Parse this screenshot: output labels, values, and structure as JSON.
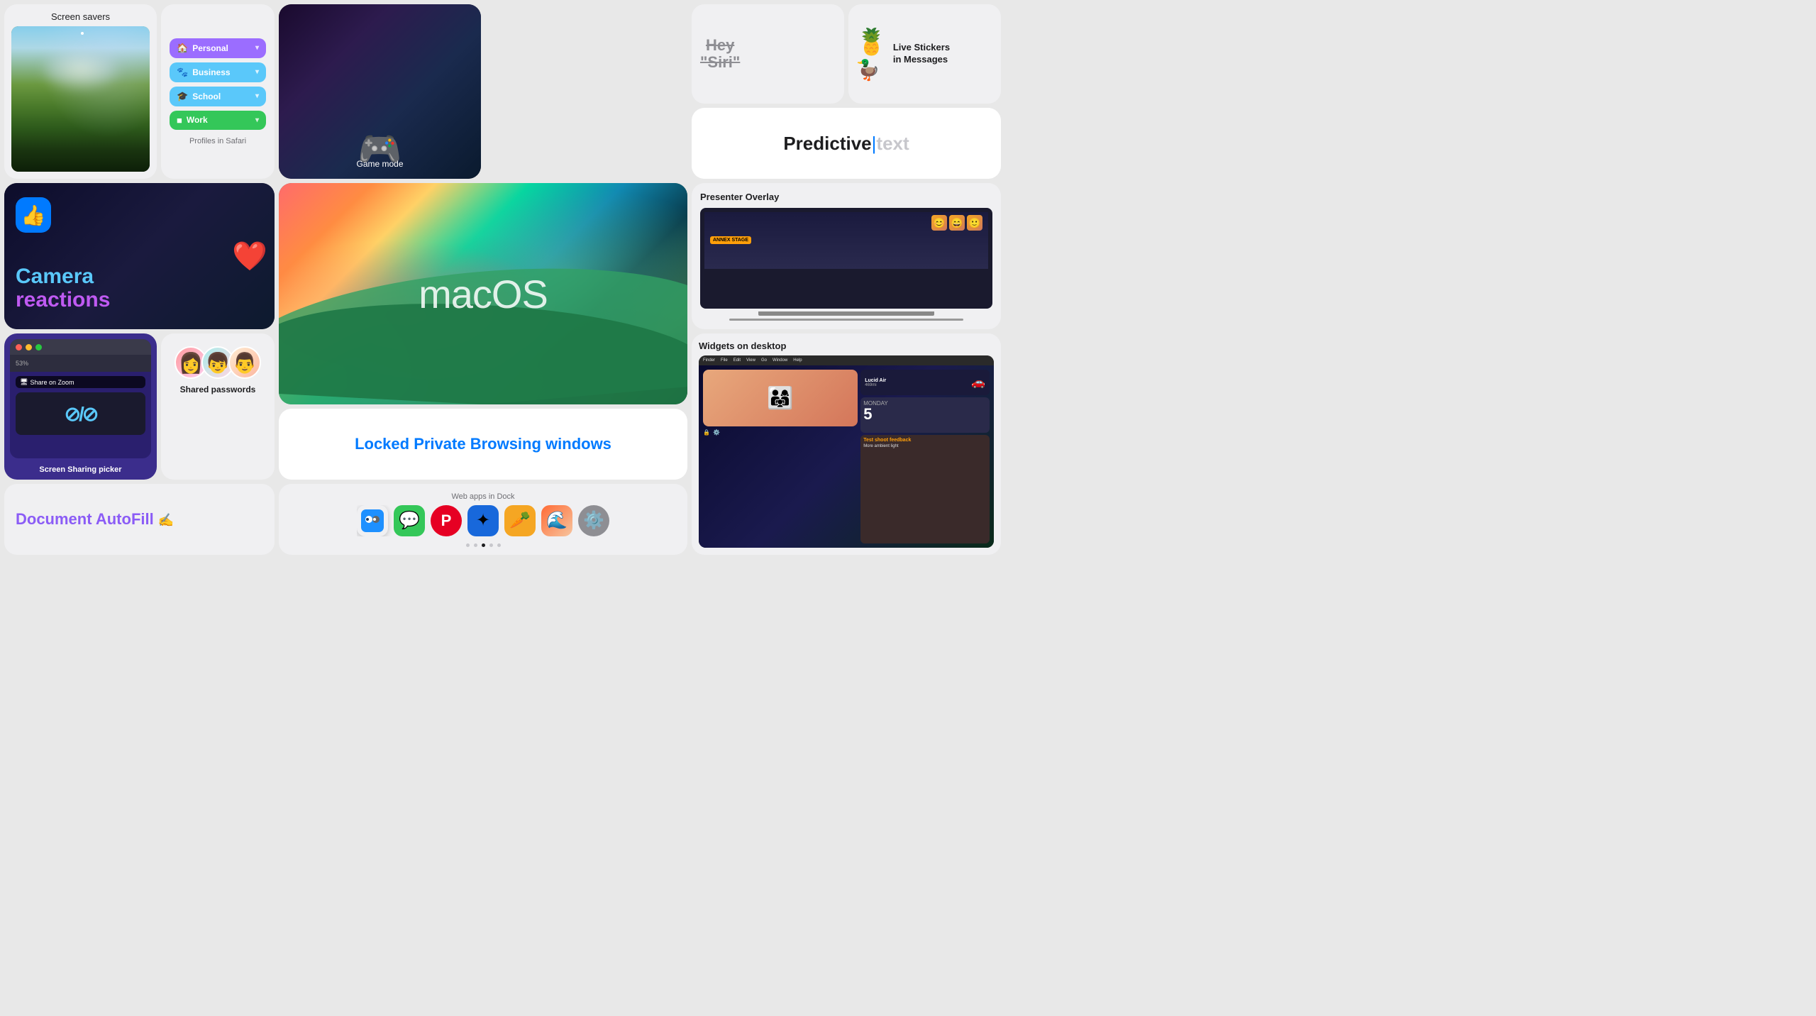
{
  "screensavers": {
    "title": "Screen savers"
  },
  "profiles": {
    "title": "Profiles in Safari",
    "items": [
      {
        "label": "Personal",
        "icon": "🏠",
        "color": "personal"
      },
      {
        "label": "Business",
        "icon": "🐾",
        "color": "business"
      },
      {
        "label": "School",
        "icon": "🎓",
        "color": "school"
      },
      {
        "label": "Work",
        "icon": "□",
        "color": "work"
      }
    ]
  },
  "gamemode": {
    "title": "Game mode"
  },
  "siri": {
    "hey": "Hey",
    "quote_open": "\"",
    "siri": "Siri",
    "quote_close": "\""
  },
  "stickers": {
    "title": "Live Stickers\nin Messages"
  },
  "predictive": {
    "word1": "Predictive",
    "word2": "text"
  },
  "camera": {
    "line1": "Camera",
    "line2": "reactions"
  },
  "macos": {
    "title": "macOS"
  },
  "locked": {
    "text": "Locked Private Browsing windows"
  },
  "webapps": {
    "label": "Web apps in Dock",
    "dots": [
      false,
      false,
      true,
      false,
      false
    ]
  },
  "screenshare": {
    "label": "Screen Sharing picker",
    "percent": "53%",
    "zoom_label": "Share on Zoom"
  },
  "passwords": {
    "title": "Shared passwords"
  },
  "autofill": {
    "title": "Document AutoFill"
  },
  "presenter": {
    "title": "Presenter Overlay",
    "badge": "ANNEX STAGE"
  },
  "widgets": {
    "title": "Widgets on desktop",
    "car_label": "Lucid Air",
    "car_miles": "469mi",
    "cal_day": "MONDAY",
    "cal_num": "5",
    "reminder_title": "Test shoot feedback",
    "reminder_sub": "More ambient light"
  }
}
